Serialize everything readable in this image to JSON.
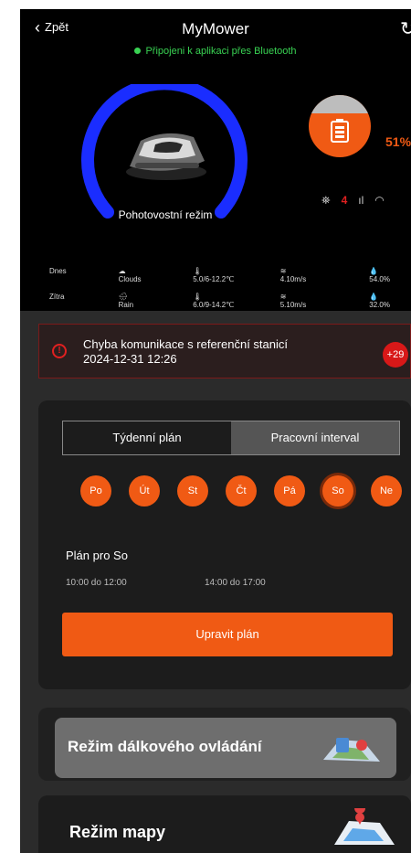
{
  "header": {
    "back_label": "Zpět",
    "title": "MyMower",
    "bluetooth_status": "Připojeni k aplikaci přes Bluetooth"
  },
  "mower": {
    "mode": "Pohotovostní režim",
    "battery_percent_text": "51%",
    "battery_level": 0.51,
    "alert_count_icon": "4"
  },
  "weather": [
    {
      "day": "Dnes",
      "condition": "Clouds",
      "temp": "5.0/6-12.2℃",
      "wind": "4.10m/s",
      "humidity": "54.0%"
    },
    {
      "day": "Zítra",
      "condition": "Rain",
      "temp": "6.0/9-14.2℃",
      "wind": "5.10m/s",
      "humidity": "32.0%"
    }
  ],
  "alert": {
    "message": "Chyba komunikace s referenční stanicí",
    "timestamp": "2024-12-31 12:26",
    "count": "+29"
  },
  "schedule": {
    "tabs": [
      "Týdenní plán",
      "Pracovní interval"
    ],
    "active_tab": 1,
    "days": [
      "Po",
      "Út",
      "St",
      "Čt",
      "Pá",
      "So",
      "Ne"
    ],
    "selected_day": 5,
    "plan_title": "Plán pro So",
    "intervals": [
      "10:00 do 12:00",
      "14:00 do 17:00"
    ],
    "edit_button": "Upravit plán"
  },
  "modes": {
    "remote_label": "Režim dálkového ovládání",
    "map_label": "Režim mapy"
  },
  "colors": {
    "accent": "#f05a14",
    "gauge": "#1a2dff",
    "bluetooth": "#39d353",
    "alert": "#d81818"
  }
}
